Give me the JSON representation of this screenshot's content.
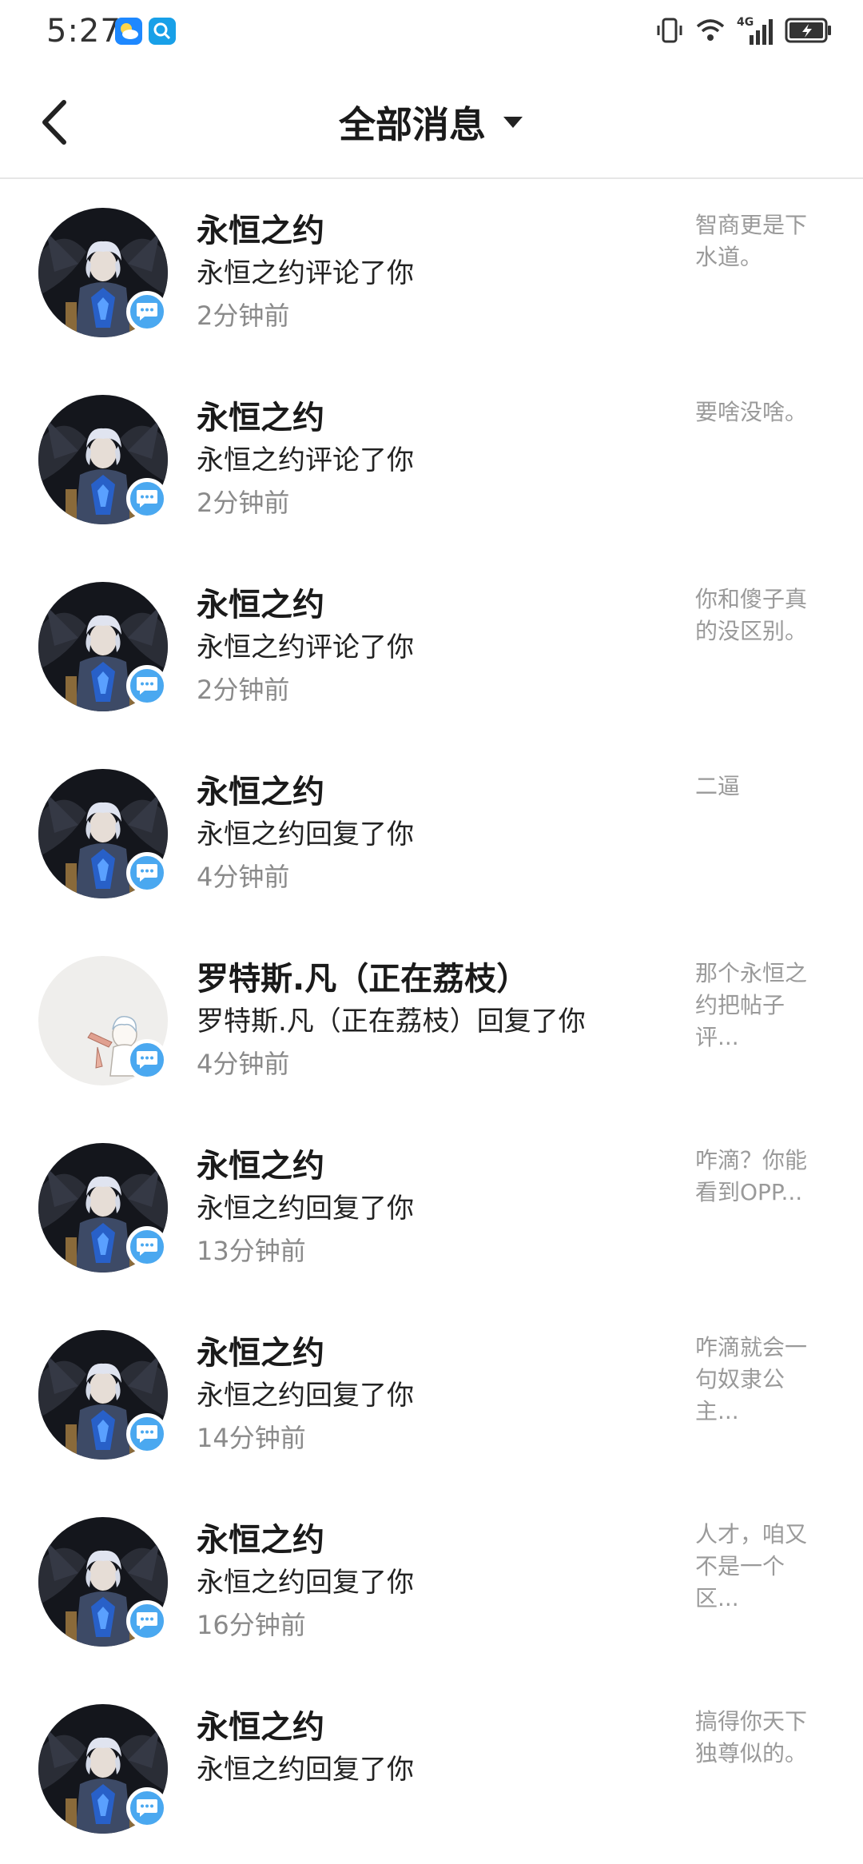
{
  "status_bar": {
    "time": "5:27",
    "network": "4G"
  },
  "header": {
    "title": "全部消息"
  },
  "messages": [
    {
      "name": "永恒之约",
      "action": "永恒之约评论了你",
      "time": "2分钟前",
      "preview": "智商更是下水道。",
      "avatar": "knight"
    },
    {
      "name": "永恒之约",
      "action": "永恒之约评论了你",
      "time": "2分钟前",
      "preview": "要啥没啥。",
      "avatar": "knight"
    },
    {
      "name": "永恒之约",
      "action": "永恒之约评论了你",
      "time": "2分钟前",
      "preview": "你和傻子真的没区别。",
      "avatar": "knight"
    },
    {
      "name": "永恒之约",
      "action": "永恒之约回复了你",
      "time": "4分钟前",
      "preview": "二逼",
      "avatar": "knight"
    },
    {
      "name": "罗特斯.凡（正在荔枝）",
      "action": "罗特斯.凡（正在荔枝）回复了你",
      "time": "4分钟前",
      "preview": "那个永恒之约把帖子评...",
      "avatar": "sketch"
    },
    {
      "name": "永恒之约",
      "action": "永恒之约回复了你",
      "time": "13分钟前",
      "preview": "咋滴？你能看到OPP...",
      "avatar": "knight"
    },
    {
      "name": "永恒之约",
      "action": "永恒之约回复了你",
      "time": "14分钟前",
      "preview": "咋滴就会一句奴隶公主...",
      "avatar": "knight"
    },
    {
      "name": "永恒之约",
      "action": "永恒之约回复了你",
      "time": "16分钟前",
      "preview": "人才，咱又不是一个区...",
      "avatar": "knight"
    },
    {
      "name": "永恒之约",
      "action": "永恒之约回复了你",
      "time": "",
      "preview": "搞得你天下独尊似的。",
      "avatar": "knight"
    }
  ]
}
